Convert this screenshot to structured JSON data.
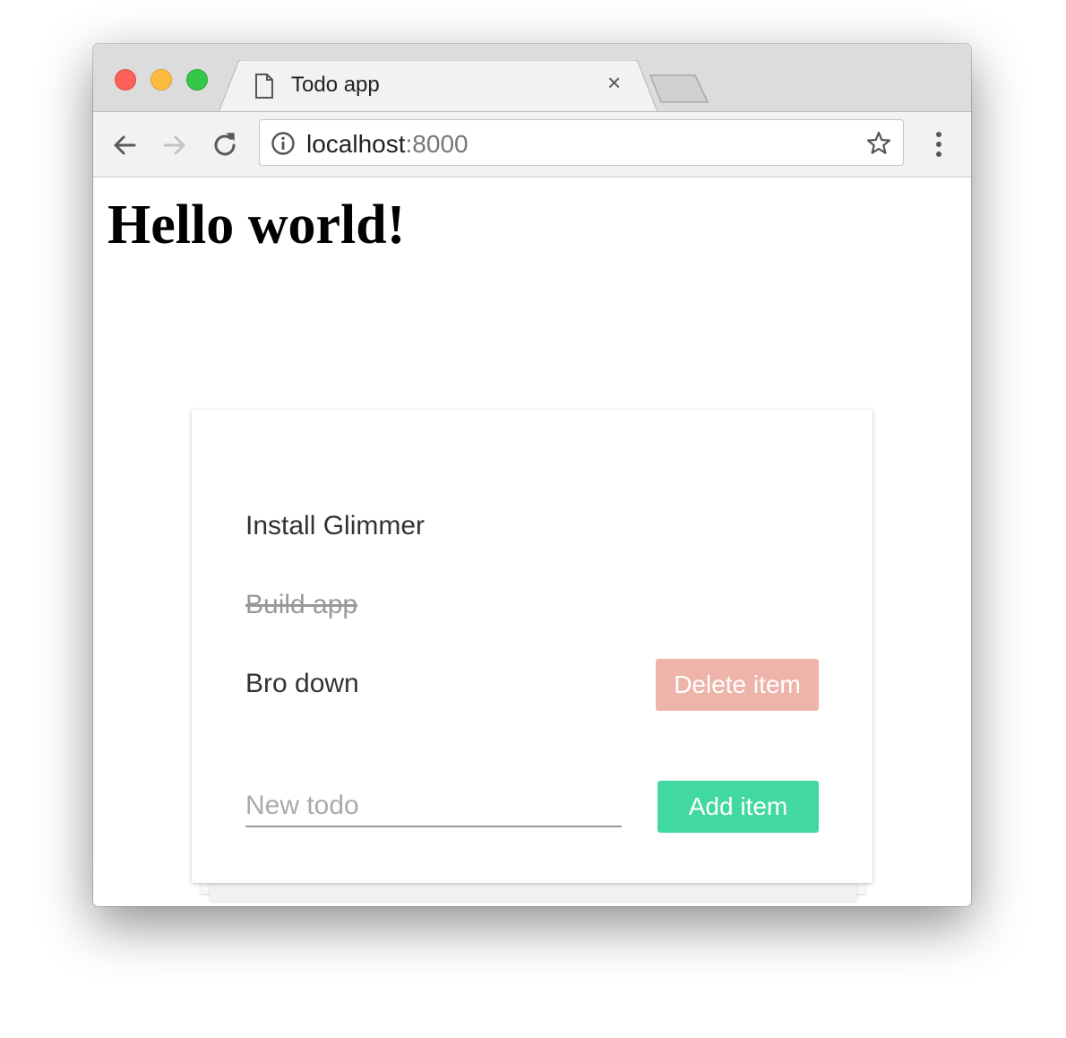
{
  "browser": {
    "tab_title": "Todo app",
    "tab_close": "×",
    "url_host": "localhost",
    "url_port": ":8000"
  },
  "page": {
    "heading": "Hello world!"
  },
  "todos": [
    {
      "text": "Install Glimmer",
      "completed": false
    },
    {
      "text": "Build app",
      "completed": true
    },
    {
      "text": "Bro down",
      "completed": false
    }
  ],
  "actions": {
    "delete_label": "Delete item",
    "add_label": "Add item",
    "new_placeholder": "New todo"
  },
  "colors": {
    "delete_button": "#eeb4aa",
    "add_button": "#42d9a0"
  },
  "icons": {
    "tab": "page-icon",
    "back": "arrow-left-icon",
    "forward": "arrow-right-icon",
    "reload": "reload-icon",
    "info": "info-icon",
    "bookmark": "star-icon",
    "menu": "kebab-menu-icon"
  }
}
